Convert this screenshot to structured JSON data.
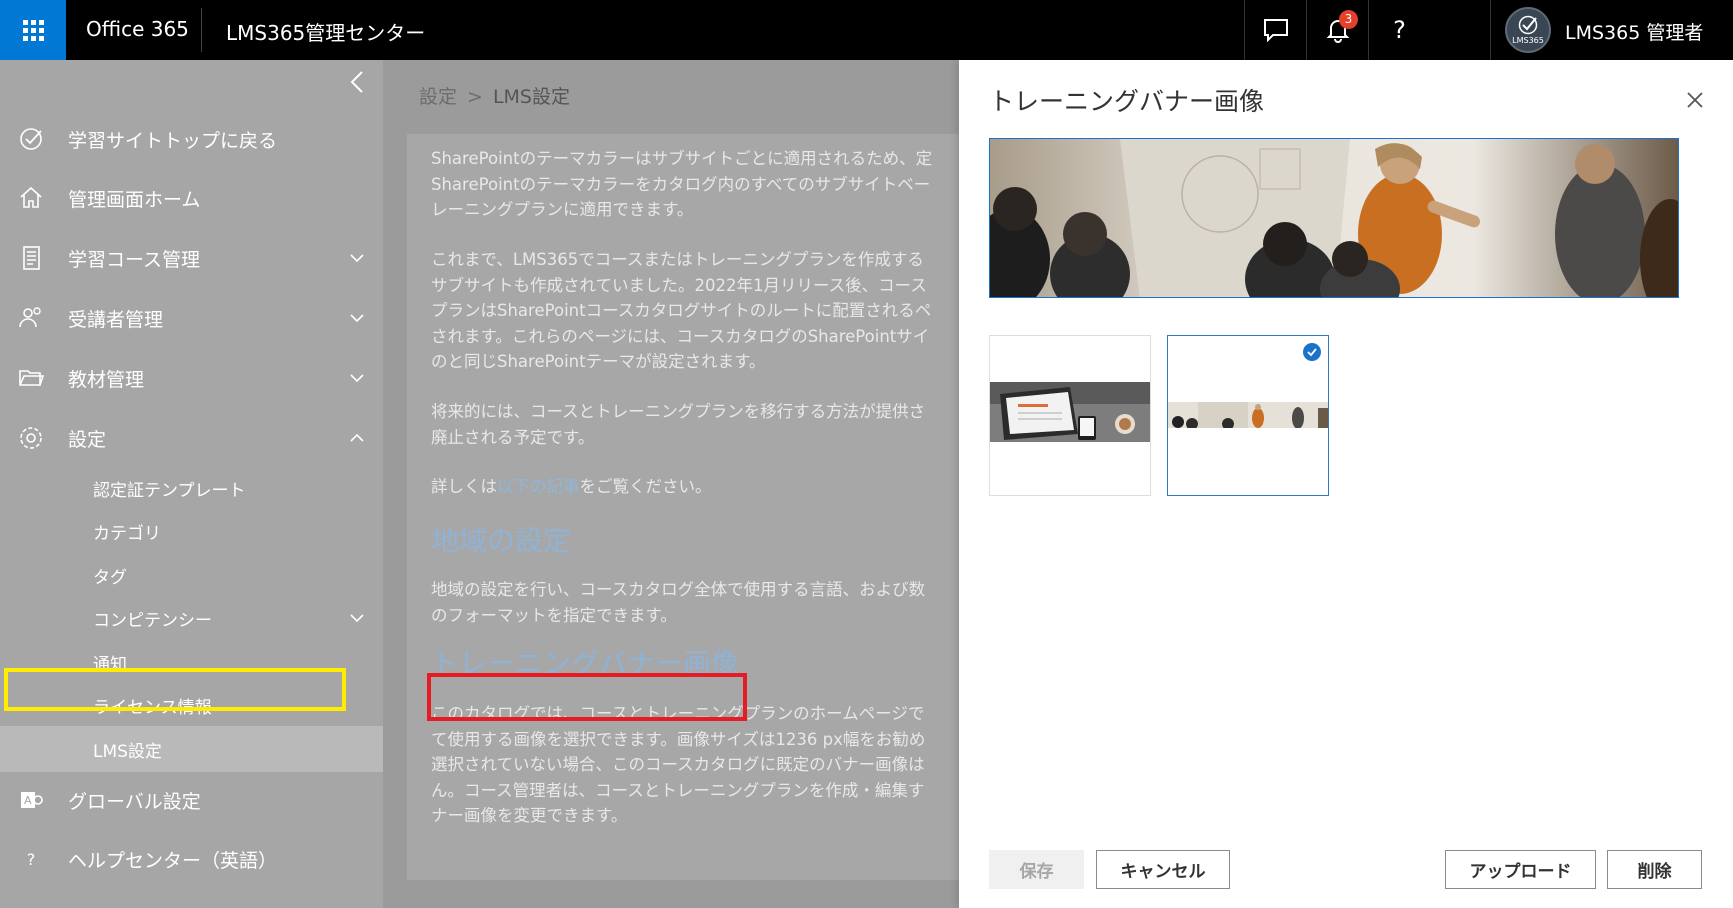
{
  "topbar": {
    "brand": "Office 365",
    "app_title": "LMS365管理センター",
    "notification_count": "3",
    "help_label": "?",
    "user_name": "LMS365 管理者",
    "avatar_caption": "LMS365"
  },
  "nav": {
    "items": [
      {
        "label": "学習サイトトップに戻る",
        "icon": "check-circle-icon"
      },
      {
        "label": "管理画面ホーム",
        "icon": "home-icon"
      },
      {
        "label": "学習コース管理",
        "icon": "document-icon"
      },
      {
        "label": "受講者管理",
        "icon": "people-icon"
      },
      {
        "label": "教材管理",
        "icon": "folder-icon"
      },
      {
        "label": "設定",
        "icon": "gear-icon"
      }
    ],
    "sub_items": [
      "認定証テンプレート",
      "カテゴリ",
      "タグ",
      "コンピテンシー",
      "通知",
      "ライセンス情報",
      "LMS設定"
    ],
    "bottom_items": [
      {
        "label": "グローバル設定",
        "icon": "global-settings-icon"
      },
      {
        "label": "ヘルプセンター（英語）",
        "icon": "help-icon"
      }
    ],
    "help_glyph": "?"
  },
  "main": {
    "breadcrumb_root": "設定",
    "breadcrumb_sep": ">",
    "breadcrumb_current": "LMS設定",
    "p1": [
      "SharePointのテーマカラーはサブサイトごとに適用されるため、定",
      "SharePointのテーマカラーをカタログ内のすべてのサブサイトベー",
      "レーニングプランに適用できます。"
    ],
    "p2": [
      "これまで、LMS365でコースまたはトレーニングプランを作成する",
      "サブサイトも作成されていました。2022年1月リリース後、コース",
      "プランはSharePointコースカタログサイトのルートに配置されるペ",
      "されます。これらのページには、コースカタログのSharePointサイ",
      "のと同じSharePointテーマが設定されます。"
    ],
    "p3": [
      "将来的には、コースとトレーニングプランを移行する方法が提供さ",
      "廃止される予定です。"
    ],
    "p4_prefix": "詳しくは",
    "p4_link": "以下の記事",
    "p4_suffix": "をご覧ください。",
    "region_heading": "地域の設定",
    "p5": [
      "地域の設定を行い、コースカタログ全体で使用する言語、および数",
      "のフォーマットを指定できます。"
    ],
    "banner_heading": "トレーニングバナー画像",
    "p6": [
      "このカタログでは、コースとトレーニングプランのホームページで",
      "て使用する画像を選択できます。画像サイズは1236 px幅をお勧め",
      "選択されていない場合、このコースカタログに既定のバナー画像は",
      "ん。コース管理者は、コースとトレーニングプランを作成・編集す",
      "ナー画像を変更できます。"
    ]
  },
  "panel": {
    "title": "トレーニングバナー画像",
    "buttons": {
      "save": "保存",
      "cancel": "キャンセル",
      "upload": "アップロード",
      "delete": "削除"
    }
  }
}
